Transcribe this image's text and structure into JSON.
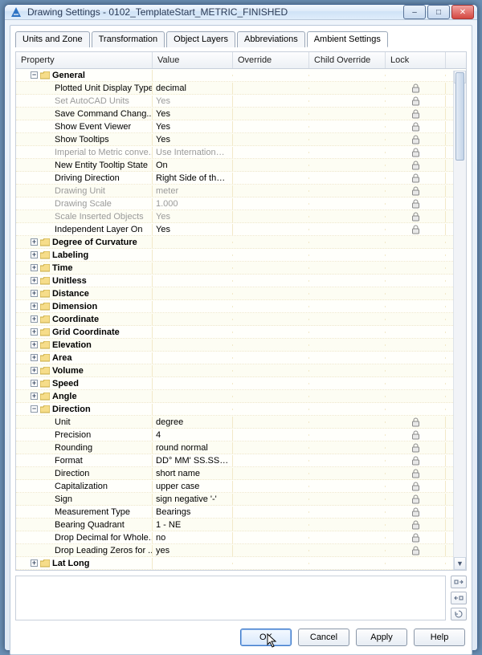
{
  "window": {
    "title": "Drawing Settings - 0102_TemplateStart_METRIC_FINISHED"
  },
  "tabs": [
    {
      "label": "Units and Zone"
    },
    {
      "label": "Transformation"
    },
    {
      "label": "Object Layers"
    },
    {
      "label": "Abbreviations"
    },
    {
      "label": "Ambient Settings"
    }
  ],
  "active_tab": "Ambient Settings",
  "columns": {
    "property": "Property",
    "value": "Value",
    "override": "Override",
    "child_override": "Child Override",
    "lock": "Lock"
  },
  "groups": {
    "general": {
      "label": "General",
      "rows": [
        {
          "prop": "Plotted Unit Display Type",
          "val": "decimal",
          "lock": true
        },
        {
          "prop": "Set AutoCAD Units",
          "val": "Yes",
          "lock": true,
          "gray": true
        },
        {
          "prop": "Save Command Chang...",
          "val": "Yes",
          "lock": true
        },
        {
          "prop": "Show Event Viewer",
          "val": "Yes",
          "lock": true
        },
        {
          "prop": "Show Tooltips",
          "val": "Yes",
          "lock": true
        },
        {
          "prop": "Imperial to Metric conve...",
          "val": "Use International...",
          "lock": true,
          "gray": true
        },
        {
          "prop": "New Entity Tooltip State",
          "val": "On",
          "lock": true
        },
        {
          "prop": "Driving Direction",
          "val": "Right Side of the ...",
          "lock": true
        },
        {
          "prop": "Drawing Unit",
          "val": "meter",
          "lock": true,
          "gray": true
        },
        {
          "prop": "Drawing Scale",
          "val": "1.000",
          "lock": true,
          "gray": true
        },
        {
          "prop": "Scale Inserted Objects",
          "val": "Yes",
          "lock": true,
          "gray": true
        },
        {
          "prop": "Independent Layer On",
          "val": "Yes",
          "lock": true
        }
      ]
    },
    "collapsed": [
      "Degree of Curvature",
      "Labeling",
      "Time",
      "Unitless",
      "Distance",
      "Dimension",
      "Coordinate",
      "Grid Coordinate",
      "Elevation",
      "Area",
      "Volume",
      "Speed",
      "Angle"
    ],
    "direction": {
      "label": "Direction",
      "rows": [
        {
          "prop": "Unit",
          "val": "degree",
          "lock": true
        },
        {
          "prop": "Precision",
          "val": "4",
          "lock": true
        },
        {
          "prop": "Rounding",
          "val": "round normal",
          "lock": true
        },
        {
          "prop": "Format",
          "val": "DD° MM' SS.SS\"...",
          "lock": true
        },
        {
          "prop": "Direction",
          "val": "short name",
          "lock": true
        },
        {
          "prop": "Capitalization",
          "val": "upper case",
          "lock": true
        },
        {
          "prop": "Sign",
          "val": "sign negative '-'",
          "lock": true
        },
        {
          "prop": "Measurement Type",
          "val": "Bearings",
          "lock": true
        },
        {
          "prop": "Bearing Quadrant",
          "val": "1 - NE",
          "lock": true
        },
        {
          "prop": "Drop Decimal for Whole...",
          "val": "no",
          "lock": true
        },
        {
          "prop": "Drop Leading Zeros for ...",
          "val": "yes",
          "lock": true
        }
      ]
    },
    "latlong": {
      "label": "Lat Long"
    }
  },
  "buttons": {
    "ok": "OK",
    "cancel": "Cancel",
    "apply": "Apply",
    "help": "Help"
  }
}
